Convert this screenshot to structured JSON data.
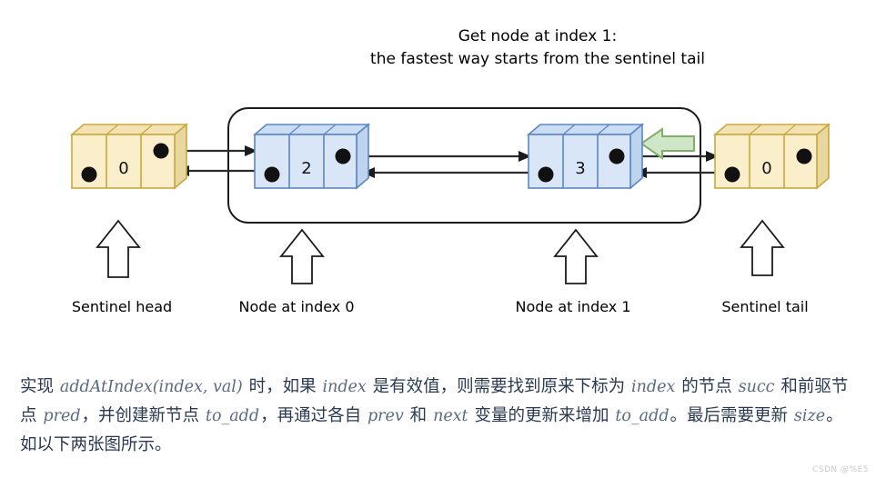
{
  "title": {
    "line1": "Get node at index 1:",
    "line2": "the fastest way starts from the sentinel tail"
  },
  "colors": {
    "sentinel_fill": "#fbeecb",
    "sentinel_top": "#f3e3b4",
    "sentinel_side": "#e8d79f",
    "sentinel_stroke": "#caa83f",
    "node_fill": "#d9e6f7",
    "node_top": "#cbddf3",
    "node_side": "#bed3ee",
    "node_stroke": "#5b87c4",
    "green_arrow_fill": "#cfe6c8",
    "green_arrow_stroke": "#7fb069",
    "line": "#2b2b2b",
    "text": "#000000",
    "paragraph_text": "#2b3a52",
    "code_text": "#5a6a80",
    "watermark": "#c9c9c9"
  },
  "nodes": [
    {
      "id": "sentinel-head",
      "value": "0",
      "kind": "sentinel",
      "caption": "Sentinel head"
    },
    {
      "id": "node-index-0",
      "value": "2",
      "kind": "node",
      "caption": "Node at index 0"
    },
    {
      "id": "node-index-1",
      "value": "3",
      "kind": "node",
      "caption": "Node at index 1"
    },
    {
      "id": "sentinel-tail",
      "value": "0",
      "kind": "sentinel",
      "caption": "Sentinel tail"
    }
  ],
  "captions": {
    "sentinel_head": "Sentinel head",
    "node_index_0": "Node at index 0",
    "node_index_1": "Node at index 1",
    "sentinel_tail": "Sentinel tail"
  },
  "annotations": {
    "green_arrow": "traversal-direction-left"
  },
  "paragraph": {
    "p1_a": "实现 ",
    "p1_code1": "addAtIndex(index, val)",
    "p1_b": " 时，如果 ",
    "p1_code2": "index",
    "p1_c": " 是有效值，则需要找到原来下标为 ",
    "p1_code3": "index",
    "p1_d": " 的节点 ",
    "p1_code4": "succ",
    "p1_e": " 和前驱节点 ",
    "p1_code5": "pred",
    "p1_f": "，并创建新节点 ",
    "p1_code6": "to_add",
    "p1_g": "，再通过各自 ",
    "p1_code7": "prev",
    "p1_h": " 和 ",
    "p1_code8": "next",
    "p1_i": " 变量的更新来增加 ",
    "p1_code9": "to_add",
    "p1_j": "。最后需要更新 ",
    "p1_code10": "size",
    "p1_k": "。如以下两张图所示。"
  },
  "watermark": "CSDN @%E5"
}
